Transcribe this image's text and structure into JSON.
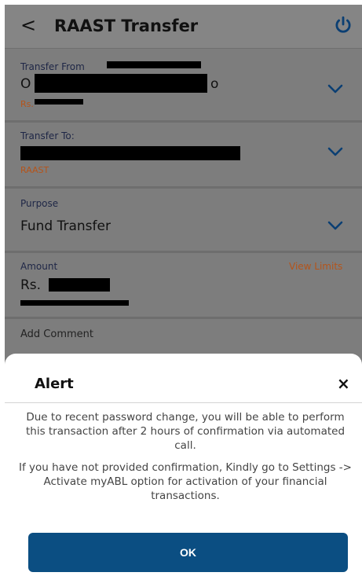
{
  "header": {
    "back_icon": "<",
    "title": "RAAST Transfer",
    "power_icon": "power-icon"
  },
  "transfer_from": {
    "label": "Transfer From",
    "value_start": "O",
    "value_end": "o",
    "sub": "Rs."
  },
  "transfer_to": {
    "label": "Transfer To:",
    "sub": "RAAST"
  },
  "purpose": {
    "label": "Purpose",
    "value": "Fund Transfer"
  },
  "amount": {
    "label": "Amount",
    "view_limits": "View Limits",
    "value": "Rs."
  },
  "comment": {
    "placeholder": "Add Comment"
  },
  "alert": {
    "title": "Alert",
    "close": "×",
    "message1": "Due to recent password change, you will be able to perform this transaction after 2 hours of confirmation via automated call.",
    "message2": "If you have not provided confirmation, Kindly go to Settings -> Activate myABL option for activation of your financial transactions.",
    "ok_label": "OK"
  },
  "colors": {
    "accent": "#0b4e82",
    "overlay": "#7d7d7d",
    "sub_text": "#b5541a"
  }
}
